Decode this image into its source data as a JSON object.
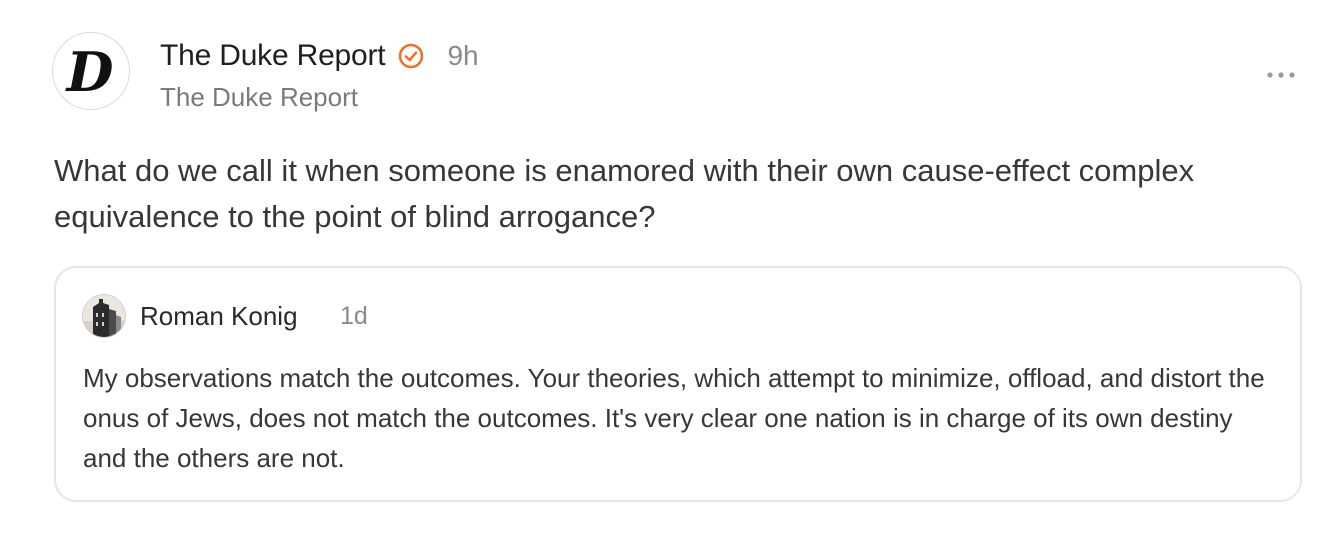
{
  "post": {
    "author": {
      "name": "The Duke Report",
      "handle": "The Duke Report",
      "avatar_letter": "D",
      "verified_icon": "verified-check-circle-icon"
    },
    "timestamp": "9h",
    "menu_icon": "more-horizontal-icon",
    "body": "What do we call it when someone is enamored with their own cause-effect complex equivalence to the point of blind arrogance?",
    "quoted_note": {
      "author": "Roman Konig",
      "timestamp": "1d",
      "body": "My observations match the outcomes. Your theories, which attempt to minimize, offload, and distort the onus of Jews, does not match the outcomes. It's very clear one nation is in charge of its own destiny and the others are not."
    }
  },
  "colors": {
    "verified_accent": "#e8742c",
    "text_primary": "#363737",
    "text_secondary": "#8a8a8a",
    "card_border": "#e6e6e6"
  }
}
